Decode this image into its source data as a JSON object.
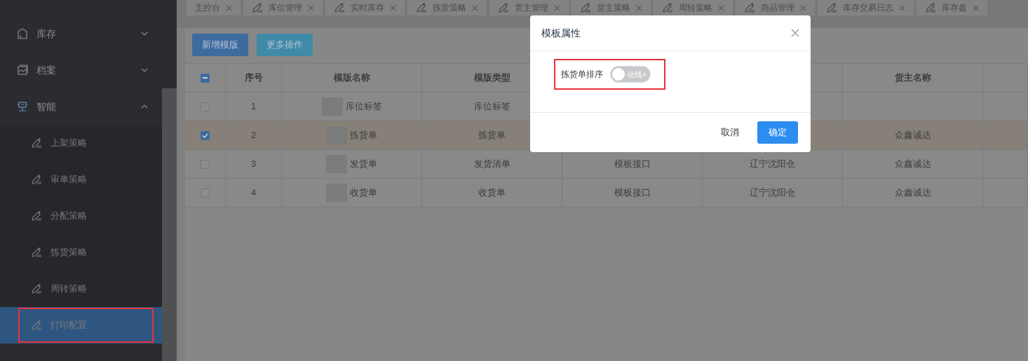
{
  "sidebar": {
    "items": [
      {
        "label": "库存",
        "expanded": false
      },
      {
        "label": "档案",
        "expanded": false
      },
      {
        "label": "智能",
        "expanded": true,
        "children": [
          {
            "label": "上架策略",
            "selected": false
          },
          {
            "label": "审单策略",
            "selected": false
          },
          {
            "label": "分配策略",
            "selected": false
          },
          {
            "label": "拣货策略",
            "selected": false
          },
          {
            "label": "周转策略",
            "selected": false
          },
          {
            "label": "打印配置",
            "selected": true
          }
        ]
      }
    ]
  },
  "tabs": [
    {
      "label": "主控台",
      "kind": "plain"
    },
    {
      "label": "库位管理",
      "kind": "page"
    },
    {
      "label": "实时库存",
      "kind": "page"
    },
    {
      "label": "拣货策略",
      "kind": "page"
    },
    {
      "label": "货主管理",
      "kind": "page"
    },
    {
      "label": "货主策略",
      "kind": "page"
    },
    {
      "label": "周转策略",
      "kind": "page"
    },
    {
      "label": "商品管理",
      "kind": "page"
    },
    {
      "label": "库存交易日志",
      "kind": "page"
    },
    {
      "label": "库存盘",
      "kind": "page"
    }
  ],
  "toolbar": {
    "buttons": [
      {
        "label": "新增模版",
        "kind": "primary"
      },
      {
        "label": "更多操作",
        "kind": "info"
      }
    ]
  },
  "table": {
    "select_all_indeterminate": true,
    "columns": {
      "no": "序号",
      "name": "模版名称",
      "type": "模版类型",
      "owner": "货主名称"
    },
    "rows": [
      {
        "checked": false,
        "no": "1",
        "name": "库位标签",
        "type": "库位标签"
      },
      {
        "checked": true,
        "no": "2",
        "name": "拣货单",
        "type": "拣货单",
        "owner": "众鑫诚达"
      },
      {
        "checked": false,
        "no": "3",
        "name": "发货单",
        "type": "发货清单",
        "column_4": "模板接口",
        "column_5": "辽宁沈阳仓",
        "owner": "众鑫诚达"
      },
      {
        "checked": false,
        "no": "4",
        "name": "收货单",
        "type": "收货单",
        "column_4": "模板接口",
        "column_5": "辽宁沈阳仓",
        "owner": "众鑫诚达"
      }
    ]
  },
  "dialog": {
    "title": "模板属性",
    "field": {
      "label": "拣货单排序",
      "on": false,
      "text": "动线+"
    },
    "buttons": [
      {
        "label": "取消",
        "kind": "text"
      },
      {
        "label": "确定",
        "kind": "primary"
      }
    ]
  }
}
